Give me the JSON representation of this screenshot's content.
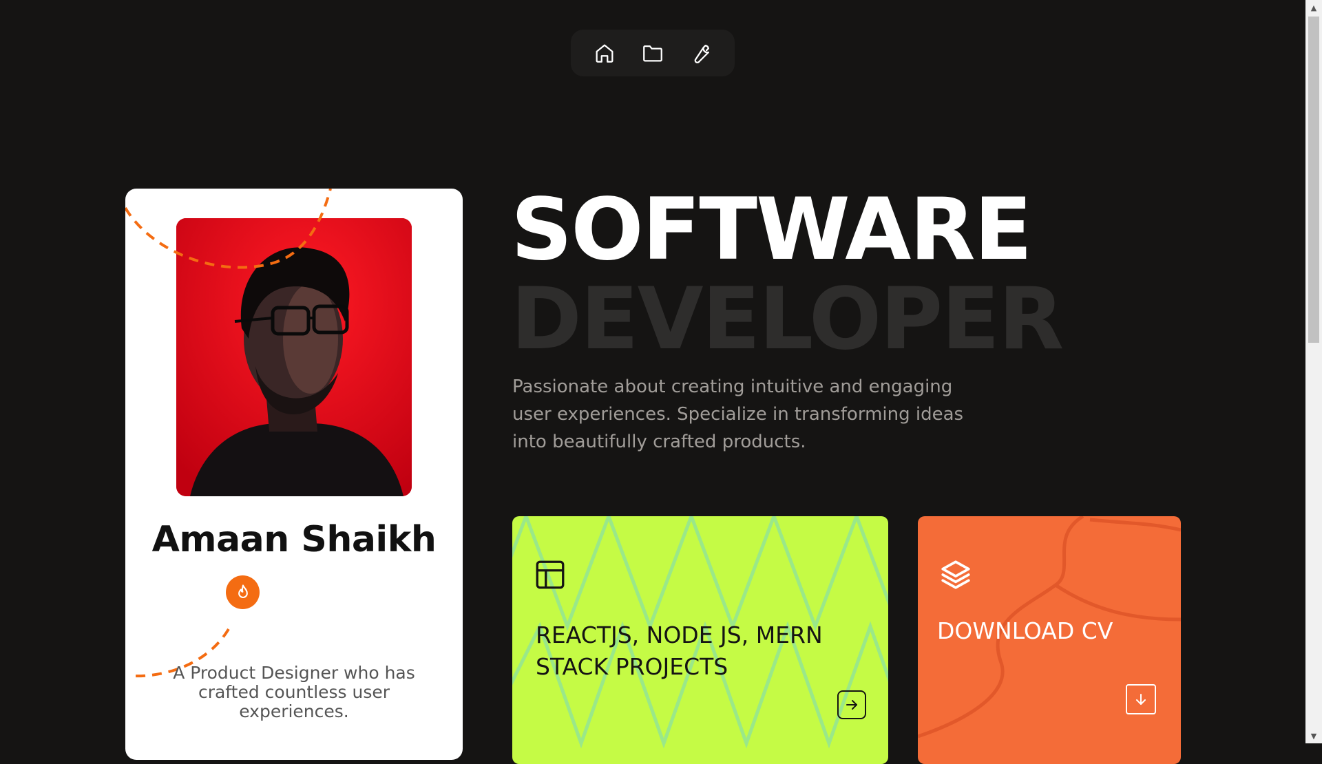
{
  "nav": {
    "items": [
      {
        "icon": "home-icon"
      },
      {
        "icon": "folder-icon"
      },
      {
        "icon": "wrench-icon"
      }
    ]
  },
  "profile": {
    "name": "Amaan Shaikh",
    "badge_icon": "flame-icon",
    "description": "A Product Designer who has crafted countless user experiences.",
    "accent": "#f46c12"
  },
  "hero": {
    "title_line1": "SOFTWARE",
    "title_line2": "DEVELOPER",
    "description": "Passionate about creating intuitive and engaging user experiences. Specialize in transforming ideas into beautifully crafted products."
  },
  "tiles": {
    "projects": {
      "label": "REACTJS, NODE JS, MERN STACK PROJECTS",
      "icon": "layout-icon",
      "action_icon": "arrow-right-icon",
      "color": "#c5fb45"
    },
    "cv": {
      "label": "DOWNLOAD CV",
      "icon": "layers-icon",
      "action_icon": "download-icon",
      "color": "#f46c38"
    }
  }
}
